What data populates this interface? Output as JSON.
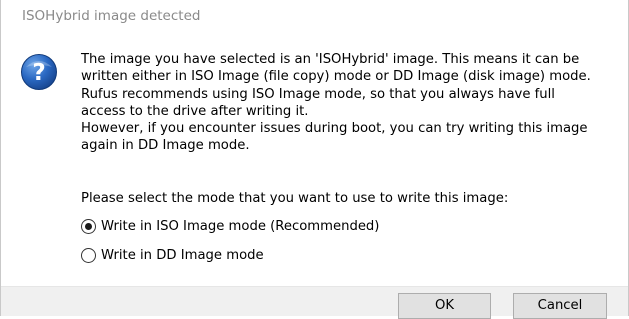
{
  "window": {
    "title": "ISOHybrid image detected"
  },
  "message": {
    "lines": [
      "The image you have selected is an 'ISOHybrid' image. This means it can be",
      "written either in ISO Image (file copy) mode or DD Image (disk image) mode.",
      "Rufus recommends using ISO Image mode, so that you always have full",
      "access to the drive after writing it.",
      "However, if you encounter issues during boot, you can try writing this image",
      "again in DD Image mode."
    ],
    "icon": "question-icon"
  },
  "prompt": "Please select the mode that you want to use to write this image:",
  "options": [
    {
      "label": "Write in ISO Image mode (Recommended)",
      "selected": true
    },
    {
      "label": "Write in DD Image mode",
      "selected": false
    }
  ],
  "buttons": {
    "ok": "OK",
    "cancel": "Cancel"
  },
  "colors": {
    "icon_blue": "#1f5fb0",
    "title_gray": "#8a8a8a",
    "footer_bg": "#f0f0f0"
  }
}
